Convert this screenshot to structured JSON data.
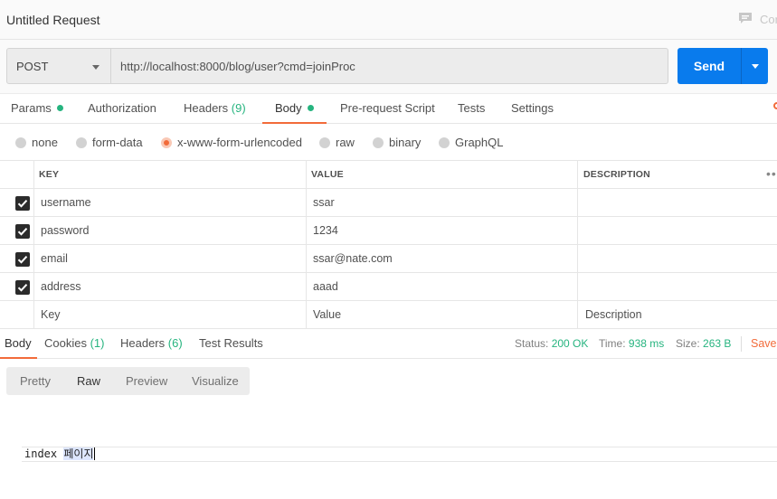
{
  "request": {
    "title": "Untitled Request",
    "comments_label": "Cor",
    "method": "POST",
    "url": "http://localhost:8000/blog/user?cmd=joinProc",
    "send_label": "Send"
  },
  "request_tabs": {
    "params": "Params",
    "authorization": "Authorization",
    "headers": "Headers",
    "headers_count": "(9)",
    "body": "Body",
    "pre_request": "Pre-request Script",
    "tests": "Tests",
    "settings": "Settings",
    "active": "Body"
  },
  "body_types": {
    "none": "none",
    "form_data": "form-data",
    "urlencoded": "x-www-form-urlencoded",
    "raw": "raw",
    "binary": "binary",
    "graphql": "GraphQL",
    "selected": "x-www-form-urlencoded"
  },
  "kv_table": {
    "headers": {
      "key": "KEY",
      "value": "VALUE",
      "description": "DESCRIPTION"
    },
    "rows": [
      {
        "checked": true,
        "key": "username",
        "value": "ssar",
        "description": ""
      },
      {
        "checked": true,
        "key": "password",
        "value": "1234",
        "description": ""
      },
      {
        "checked": true,
        "key": "email",
        "value": "ssar@nate.com",
        "description": ""
      },
      {
        "checked": true,
        "key": "address",
        "value": "aaad",
        "description": ""
      }
    ],
    "placeholders": {
      "key": "Key",
      "value": "Value",
      "description": "Description"
    }
  },
  "response_tabs": {
    "body": "Body",
    "cookies": "Cookies",
    "cookies_count": "(1)",
    "headers": "Headers",
    "headers_count": "(6)",
    "test_results": "Test Results"
  },
  "response_status": {
    "status_label": "Status:",
    "status_value": "200 OK",
    "time_label": "Time:",
    "time_value": "938 ms",
    "size_label": "Size:",
    "size_value": "263 B",
    "save_label": "Save"
  },
  "view_modes": {
    "pretty": "Pretty",
    "raw": "Raw",
    "preview": "Preview",
    "visualize": "Visualize",
    "active": "Raw"
  },
  "response_body": {
    "text_plain": "index ",
    "text_highlight": "페이지"
  },
  "colors": {
    "accent_orange": "#f26b3a",
    "send_blue": "#097bed",
    "success_green": "#26b47f"
  }
}
